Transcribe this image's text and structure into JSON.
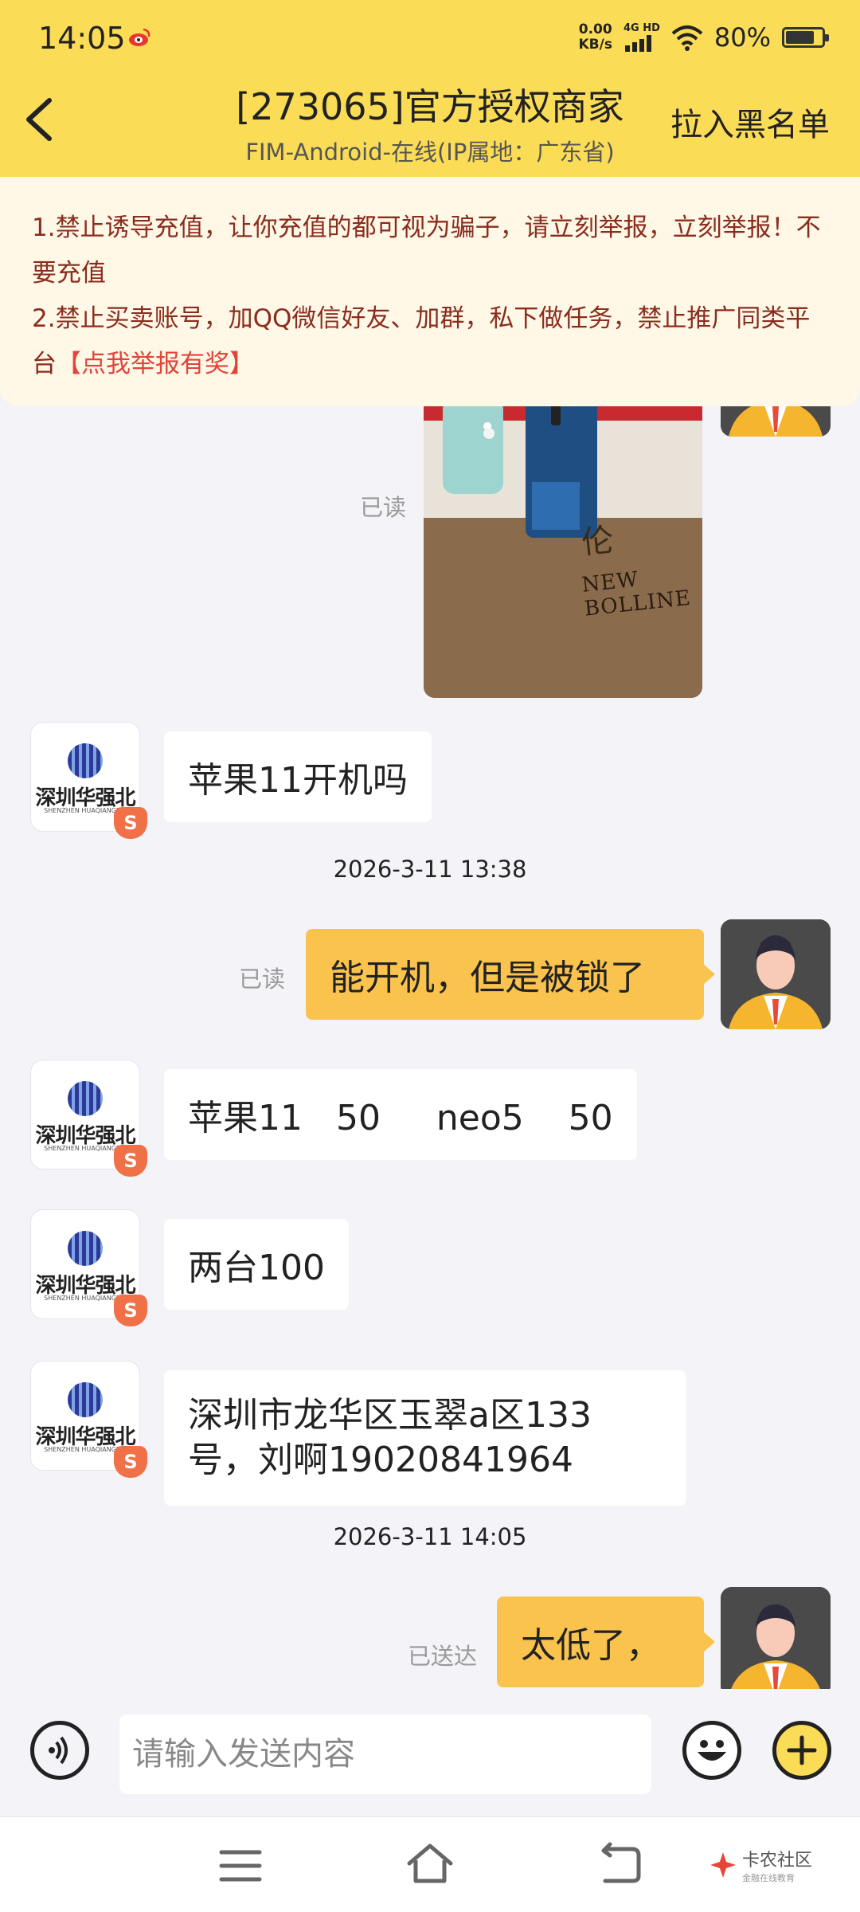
{
  "status_bar": {
    "time": "14:05",
    "net_speed_value": "0.00",
    "net_speed_unit": "KB/s",
    "network": "4G HD",
    "battery_percent": "80%",
    "battery_level": 0.8
  },
  "header": {
    "title": "[273065]官方授权商家",
    "subtitle": "FIM-Android-在线(IP属地：广东省)",
    "blacklist_label": "拉入黑名单"
  },
  "notice": {
    "line1": "1.禁止诱导充值，让你充值的都可视为骗子，请立刻举报，立刻举报！不要充值",
    "line2": "2.禁止买卖账号，加QQ微信好友、加群，私下做任务，禁止推广同类平台",
    "report_link": "【点我举报有奖】"
  },
  "shop": {
    "avatar_brand": "深圳华强北",
    "avatar_brand_en": "SHENZHEN HUAQIANGBEI",
    "avatar_badge": "S"
  },
  "chat": {
    "photo_read": "已读",
    "photo_text": "NEW BOLLINE",
    "msg1": "苹果11开机吗",
    "ts1": "2026-3-11 13:38",
    "msg2_read": "已读",
    "msg2": "能开机，但是被锁了",
    "msg3": "苹果11   50     neo5    50",
    "msg4": "两台100",
    "msg5_line1": "深圳市龙华区玉翠a区133",
    "msg5_line2": "号，刘啊19020841964",
    "ts2": "2026-3-11 14:05",
    "msg6_read": "已送达",
    "msg6": "太低了，"
  },
  "input_bar": {
    "placeholder": "请输入发送内容"
  },
  "watermark": {
    "title": "卡农社区",
    "subtitle": "金融在线教育"
  },
  "colors": {
    "header_bg": "#fbdc57",
    "outgoing_bubble": "#f9c34e",
    "notice_text": "#8a2c1e",
    "notice_link": "#e0453a"
  }
}
